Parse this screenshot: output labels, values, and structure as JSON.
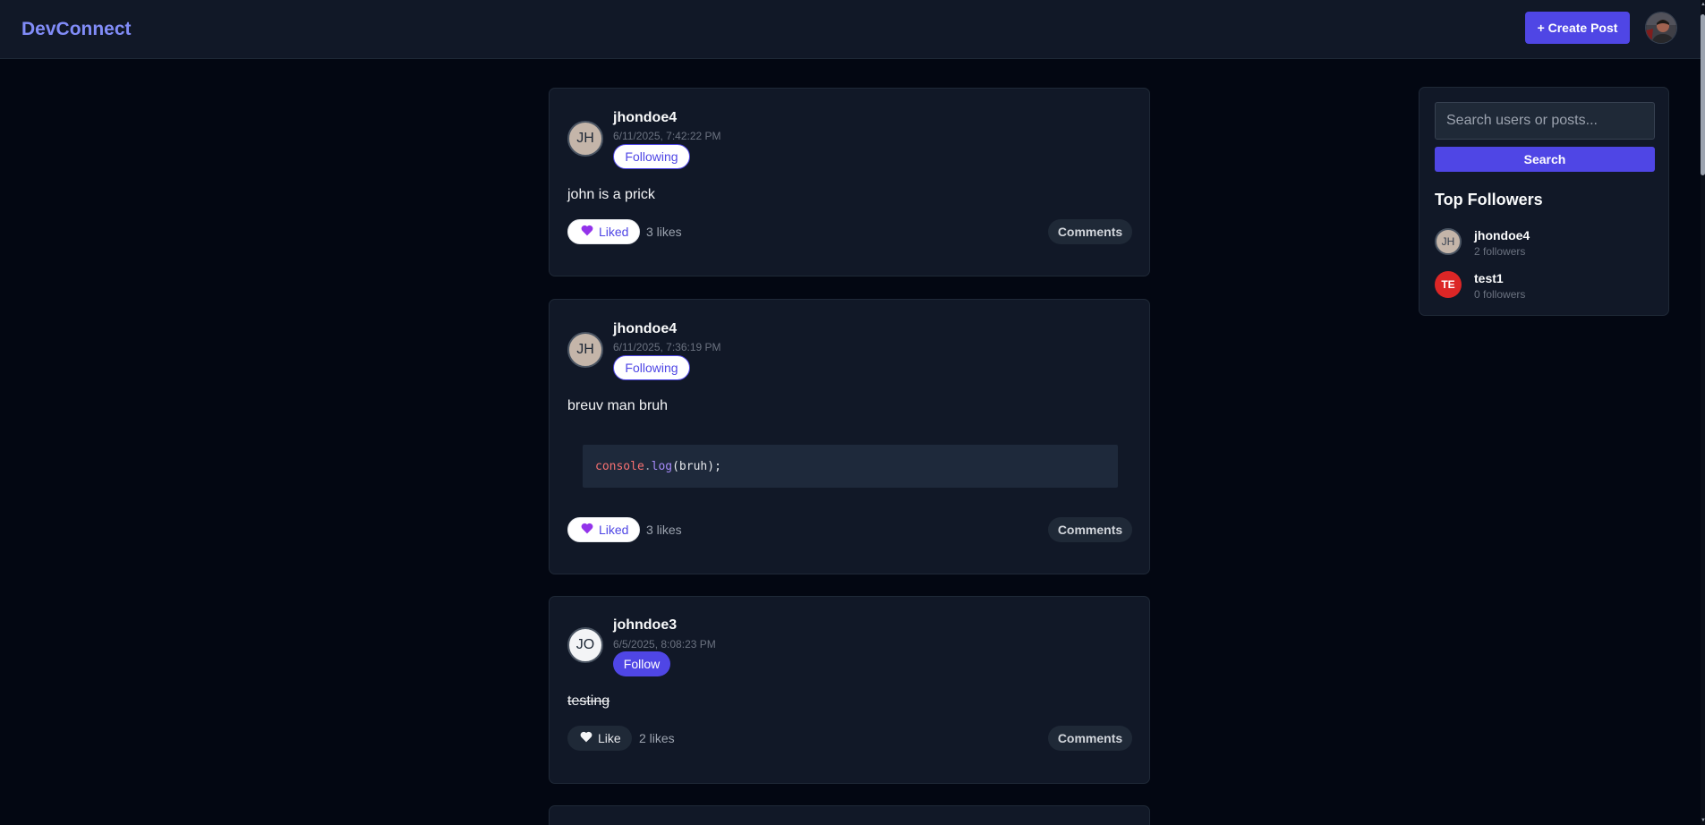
{
  "header": {
    "brand": "DevConnect",
    "create_post_label": "+ Create Post"
  },
  "posts": [
    {
      "avatar_initials": "JH",
      "username": "jhondoe4",
      "timestamp": "6/11/2025, 7:42:22 PM",
      "follow_label": "Following",
      "content": "john is a prick",
      "like_label": "Liked",
      "like_icon": "purple-heart-icon",
      "likes": "3 likes",
      "comments_label": "Comments"
    },
    {
      "avatar_initials": "JH",
      "username": "jhondoe4",
      "timestamp": "6/11/2025, 7:36:19 PM",
      "follow_label": "Following",
      "content": "breuv man bruh",
      "code": {
        "object": "console",
        "dot": ".",
        "method": "log",
        "args": "(bruh);"
      },
      "like_label": "Liked",
      "like_icon": "purple-heart-icon",
      "likes": "3 likes",
      "comments_label": "Comments"
    },
    {
      "avatar_initials": "JO",
      "username": "johndoe3",
      "timestamp": "6/5/2025, 8:08:23 PM",
      "follow_label": "Follow",
      "content": "testing",
      "like_label": "Like",
      "like_icon": "white-heart-icon",
      "likes": "2 likes",
      "comments_label": "Comments"
    }
  ],
  "sidebar": {
    "search_placeholder": "Search users or posts...",
    "search_label": "Search",
    "top_followers_title": "Top Followers",
    "top_followers": [
      {
        "initials": "JH",
        "name": "jhondoe4",
        "followers": "2 followers",
        "color": "#c4b5a9"
      },
      {
        "initials": "TE",
        "name": "test1",
        "followers": "0 followers",
        "color": "#dc2626"
      }
    ]
  },
  "colors": {
    "accent": "#4f46e5",
    "brand": "#818cf8",
    "background": "#030712",
    "card": "#111827"
  }
}
